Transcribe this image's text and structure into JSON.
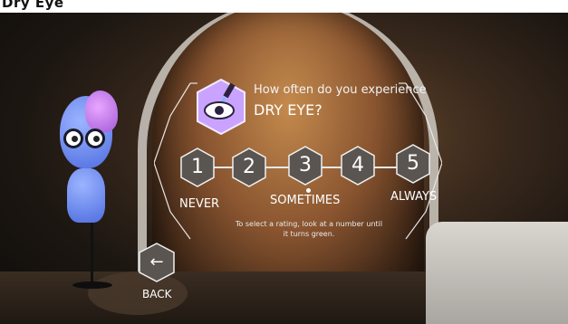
{
  "header": {
    "partial_title": "Dry Eye"
  },
  "question": {
    "prompt": "How often do you experience",
    "topic": "DRY EYE?",
    "icon": "eye-dropper-icon"
  },
  "rating": {
    "options": [
      "1",
      "2",
      "3",
      "4",
      "5"
    ],
    "labels": {
      "low": "NEVER",
      "mid": "SOMETIMES",
      "high": "ALWAYS"
    },
    "instruction_line1": "To select a rating, look at a number until",
    "instruction_line2": "it turns green."
  },
  "navigation": {
    "back_label": "BACK",
    "back_icon": "left-arrow-icon"
  },
  "colors": {
    "accent": "#ffffff",
    "hex_fill": "#5a5550",
    "icon_purple": "#c9a3ff"
  }
}
